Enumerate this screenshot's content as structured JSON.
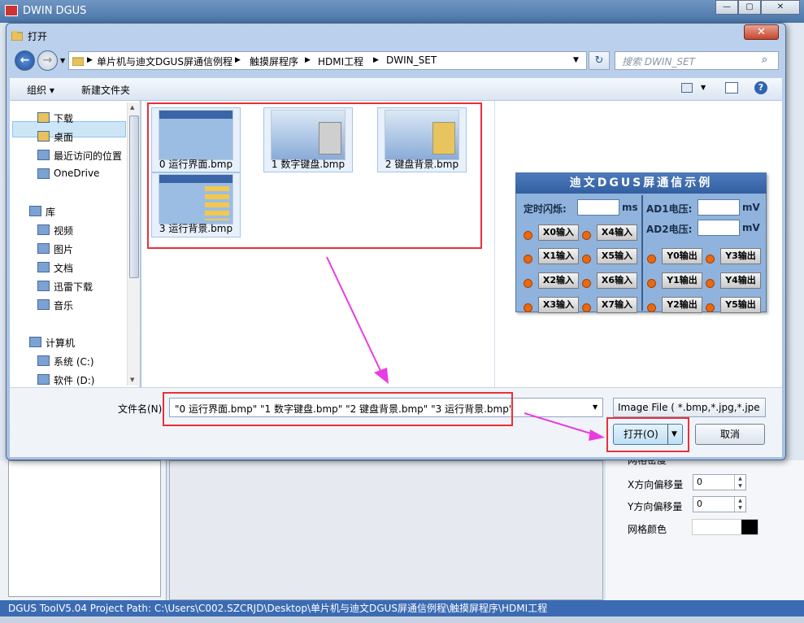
{
  "app": {
    "title": "DWIN DGUS"
  },
  "dialog": {
    "title": "打开",
    "close": "✕",
    "breadcrumb": [
      "单片机与迪文DGUS屏通信例程",
      "触摸屏程序",
      "HDMI工程",
      "DWIN_SET"
    ],
    "search_placeholder": "搜索 DWIN_SET",
    "toolbar": {
      "organize": "组织 ▾",
      "new_folder": "新建文件夹"
    },
    "nav": [
      {
        "label": "下载",
        "icon": "download-folder-icon"
      },
      {
        "label": "桌面",
        "icon": "desktop-icon"
      },
      {
        "label": "最近访问的位置",
        "icon": "recent-places-icon"
      },
      {
        "label": "OneDrive",
        "icon": "cloud-icon"
      },
      {
        "label": "库",
        "icon": "library-icon"
      },
      {
        "label": "视频",
        "icon": "video-icon"
      },
      {
        "label": "图片",
        "icon": "pictures-icon"
      },
      {
        "label": "文档",
        "icon": "documents-icon"
      },
      {
        "label": "迅雷下载",
        "icon": "download-icon"
      },
      {
        "label": "音乐",
        "icon": "music-icon"
      },
      {
        "label": "计算机",
        "icon": "computer-icon"
      },
      {
        "label": "系统 (C:)",
        "icon": "drive-icon"
      },
      {
        "label": "软件 (D:)",
        "icon": "drive-icon"
      }
    ],
    "files": [
      {
        "name": "0 运行界面.bmp"
      },
      {
        "name": "1 数字键盘.bmp"
      },
      {
        "name": "2 键盘背景.bmp"
      },
      {
        "name": "3 运行背景.bmp"
      }
    ],
    "filename_label": "文件名(N):",
    "filename_value": "\"0 运行界面.bmp\" \"1 数字键盘.bmp\" \"2 键盘背景.bmp\" \"3 运行背景.bmp\"",
    "filter_value": "Image File ( *.bmp,*.jpg,*.jpe",
    "open_button": "打开(O)",
    "cancel_button": "取消"
  },
  "preview": {
    "title": "迪文DGUS屏通信示例",
    "timer_label": "定时闪烁:",
    "timer_unit": "ms",
    "ad1_label": "AD1电压:",
    "ad2_label": "AD2电压:",
    "volt_unit": "mV",
    "inputs": [
      "X0输入",
      "X1输入",
      "X2输入",
      "X3输入",
      "X4输入",
      "X5输入",
      "X6输入",
      "X7输入"
    ],
    "outputs": [
      "Y0输出",
      "Y1输出",
      "Y2输出",
      "Y3输出",
      "Y4输出",
      "Y5输出"
    ]
  },
  "properties": {
    "grid_label": "网格密度",
    "x_offset_label": "X方向偏移量",
    "x_offset_value": "0",
    "y_offset_label": "Y方向偏移量",
    "y_offset_value": "0",
    "grid_color_label": "网格颜色"
  },
  "status": {
    "text": "DGUS ToolV5.04  Project Path: C:\\Users\\C002.SZCRJD\\Desktop\\单片机与迪文DGUS屏通信例程\\触摸屏程序\\HDMI工程"
  },
  "colors": {
    "highlight": "#e8303a",
    "arrow": "#e93ce0",
    "accent": "#3b6bb3"
  }
}
